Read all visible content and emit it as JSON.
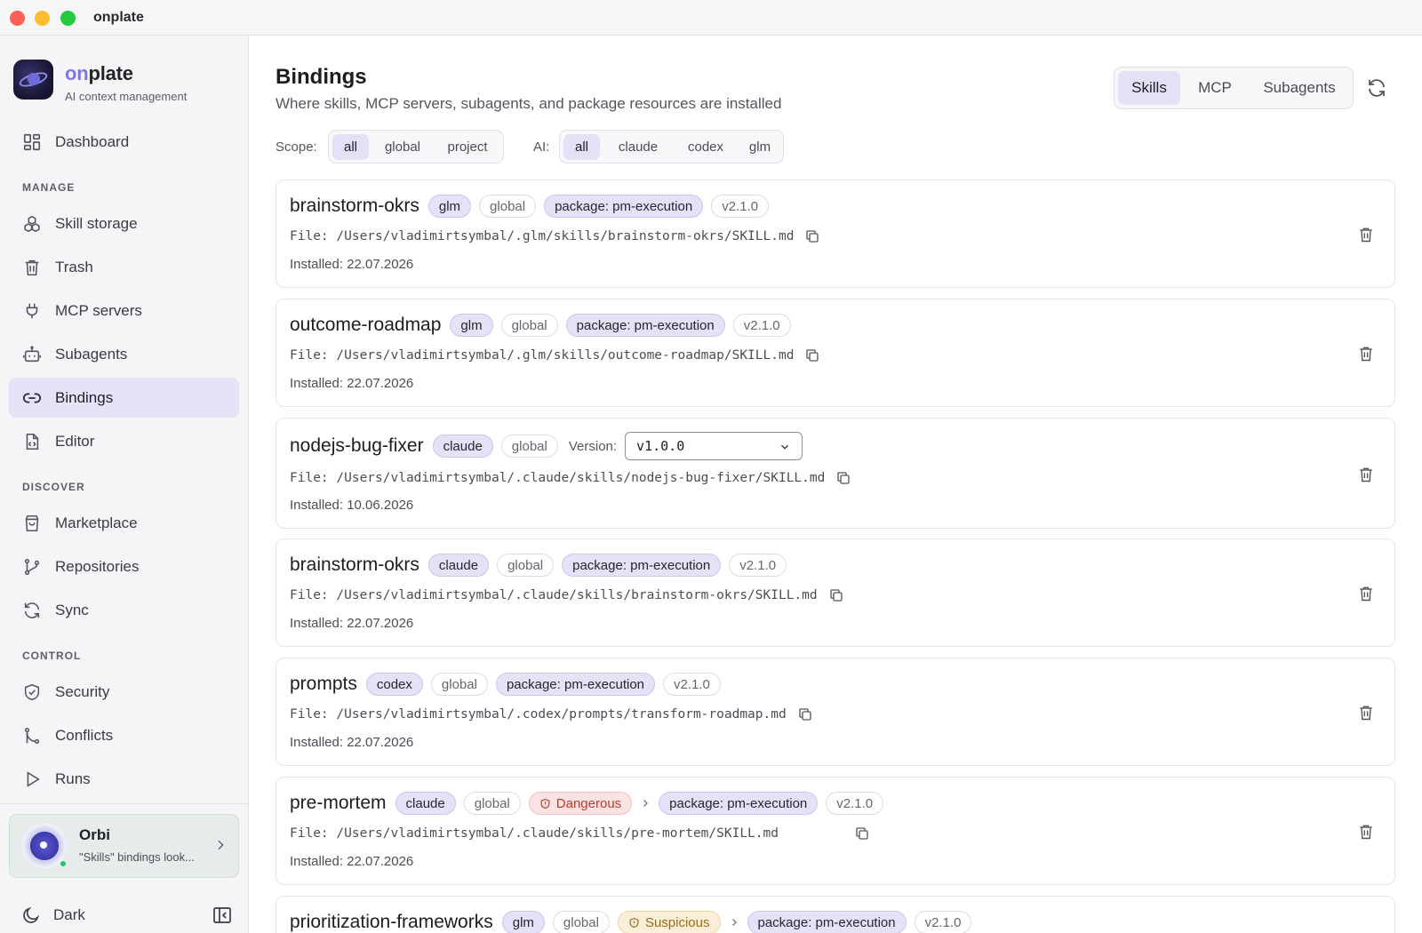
{
  "window": {
    "title": "onplate"
  },
  "brand": {
    "name_accent": "on",
    "name_rest": "plate",
    "subtitle": "AI context management"
  },
  "nav": {
    "dashboard": "Dashboard",
    "sections": {
      "manage": "MANAGE",
      "discover": "DISCOVER",
      "control": "CONTROL"
    },
    "manage": [
      "Skill storage",
      "Trash",
      "MCP servers",
      "Subagents",
      "Bindings",
      "Editor"
    ],
    "discover": [
      "Marketplace",
      "Repositories",
      "Sync"
    ],
    "control": [
      "Security",
      "Conflicts",
      "Runs"
    ],
    "active": "Bindings"
  },
  "orbi": {
    "name": "Orbi",
    "message": "\"Skills\" bindings look..."
  },
  "theme": {
    "label": "Dark"
  },
  "page": {
    "title": "Bindings",
    "subtitle": "Where skills, MCP servers, subagents, and package resources are installed"
  },
  "tabs": {
    "items": [
      "Skills",
      "MCP",
      "Subagents"
    ],
    "active": "Skills"
  },
  "filters": {
    "scope_label": "Scope:",
    "scope_options": [
      "all",
      "global",
      "project"
    ],
    "scope_selected": "all",
    "ai_label": "AI:",
    "ai_options": [
      "all",
      "claude",
      "codex",
      "glm"
    ],
    "ai_selected": "all"
  },
  "bindings": [
    {
      "name": "brainstorm-okrs",
      "ai": "glm",
      "scope": "global",
      "package": "package: pm-execution",
      "version": "v2.1.0",
      "file": "File: /Users/vladimirtsymbal/.glm/skills/brainstorm-okrs/SKILL.md",
      "installed": "Installed: 22.07.2026"
    },
    {
      "name": "outcome-roadmap",
      "ai": "glm",
      "scope": "global",
      "package": "package: pm-execution",
      "version": "v2.1.0",
      "file": "File: /Users/vladimirtsymbal/.glm/skills/outcome-roadmap/SKILL.md",
      "installed": "Installed: 22.07.2026"
    },
    {
      "name": "nodejs-bug-fixer",
      "ai": "claude",
      "scope": "global",
      "version_label": "Version:",
      "version_select": "v1.0.0",
      "file": "File: /Users/vladimirtsymbal/.claude/skills/nodejs-bug-fixer/SKILL.md",
      "installed": "Installed: 10.06.2026"
    },
    {
      "name": "brainstorm-okrs",
      "ai": "claude",
      "scope": "global",
      "package": "package: pm-execution",
      "version": "v2.1.0",
      "file": "File: /Users/vladimirtsymbal/.claude/skills/brainstorm-okrs/SKILL.md",
      "installed": "Installed: 22.07.2026"
    },
    {
      "name": "prompts",
      "ai": "codex",
      "scope": "global",
      "package": "package: pm-execution",
      "version": "v2.1.0",
      "file": "File: /Users/vladimirtsymbal/.codex/prompts/transform-roadmap.md",
      "installed": "Installed: 22.07.2026"
    },
    {
      "name": "pre-mortem",
      "ai": "claude",
      "scope": "global",
      "risk": "Dangerous",
      "package": "package: pm-execution",
      "version": "v2.1.0",
      "file": "File: /Users/vladimirtsymbal/.claude/skills/pre-mortem/SKILL.md",
      "installed": "Installed: 22.07.2026"
    },
    {
      "name": "prioritization-frameworks",
      "ai": "glm",
      "scope": "global",
      "risk": "Suspicious",
      "package": "package: pm-execution",
      "version": "v2.1.0"
    }
  ],
  "colors": {
    "accent": "#7c78e6",
    "active_bg": "#e2e1f6",
    "danger": "#c0392b",
    "warning": "#9a6b12"
  },
  "icons": {
    "dashboard": "grid-icon",
    "skill_storage": "boxes-icon",
    "trash": "trash-icon",
    "mcp": "plug-icon",
    "subagents": "bot-icon",
    "bindings": "link-icon",
    "editor": "file-code-icon",
    "marketplace": "shopping-bag-icon",
    "repositories": "git-branch-icon",
    "sync": "refresh-icon",
    "security": "shield-check-icon",
    "conflicts": "git-merge-icon",
    "runs": "play-icon",
    "copy": "copy-icon",
    "delete": "trash-icon"
  }
}
